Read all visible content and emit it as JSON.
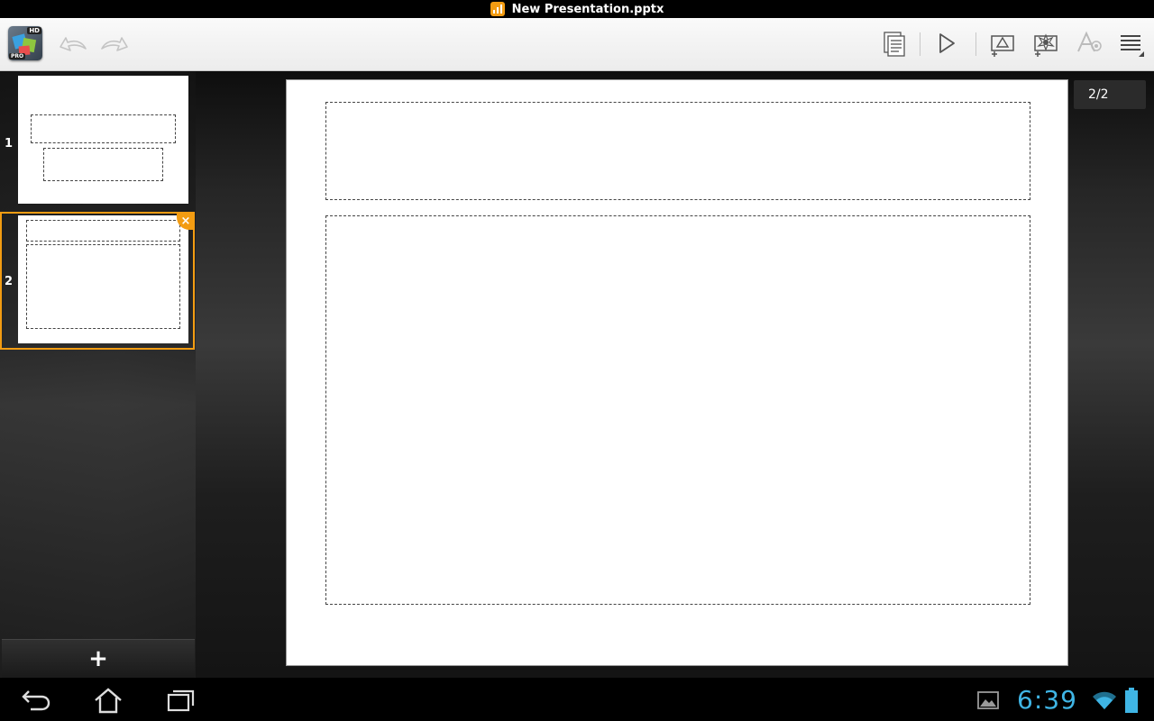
{
  "title": "New Presentation.pptx",
  "app": {
    "badge": "HD",
    "edition": "PRO"
  },
  "toolbar": {
    "icons": [
      "undo-icon",
      "redo-icon",
      "notes-icon",
      "play-icon",
      "insert-shape-icon",
      "insert-image-icon",
      "text-format-icon",
      "menu-icon"
    ]
  },
  "slides": [
    {
      "number": "1",
      "layout": "title"
    },
    {
      "number": "2",
      "layout": "title-content",
      "selected": true
    }
  ],
  "slide_panel": {
    "close_label": "×",
    "add_label": "+"
  },
  "editor": {
    "page_indicator": "2/2"
  },
  "system_bar": {
    "time": "6:39",
    "accent_color": "#3fb5e5"
  },
  "colors": {
    "accent": "#f39c12",
    "clock": "#3fb5e5"
  }
}
